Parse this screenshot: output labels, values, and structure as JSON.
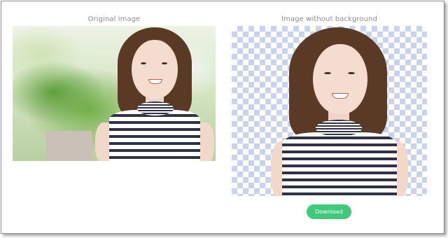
{
  "panels": {
    "original": {
      "caption": "Original image"
    },
    "result": {
      "caption": "Image without background"
    }
  },
  "actions": {
    "download_label": "Download"
  },
  "colors": {
    "download_button": "#3ec97c",
    "checkerboard": "#c9d3ec",
    "caption_text": "#8a8d93"
  }
}
